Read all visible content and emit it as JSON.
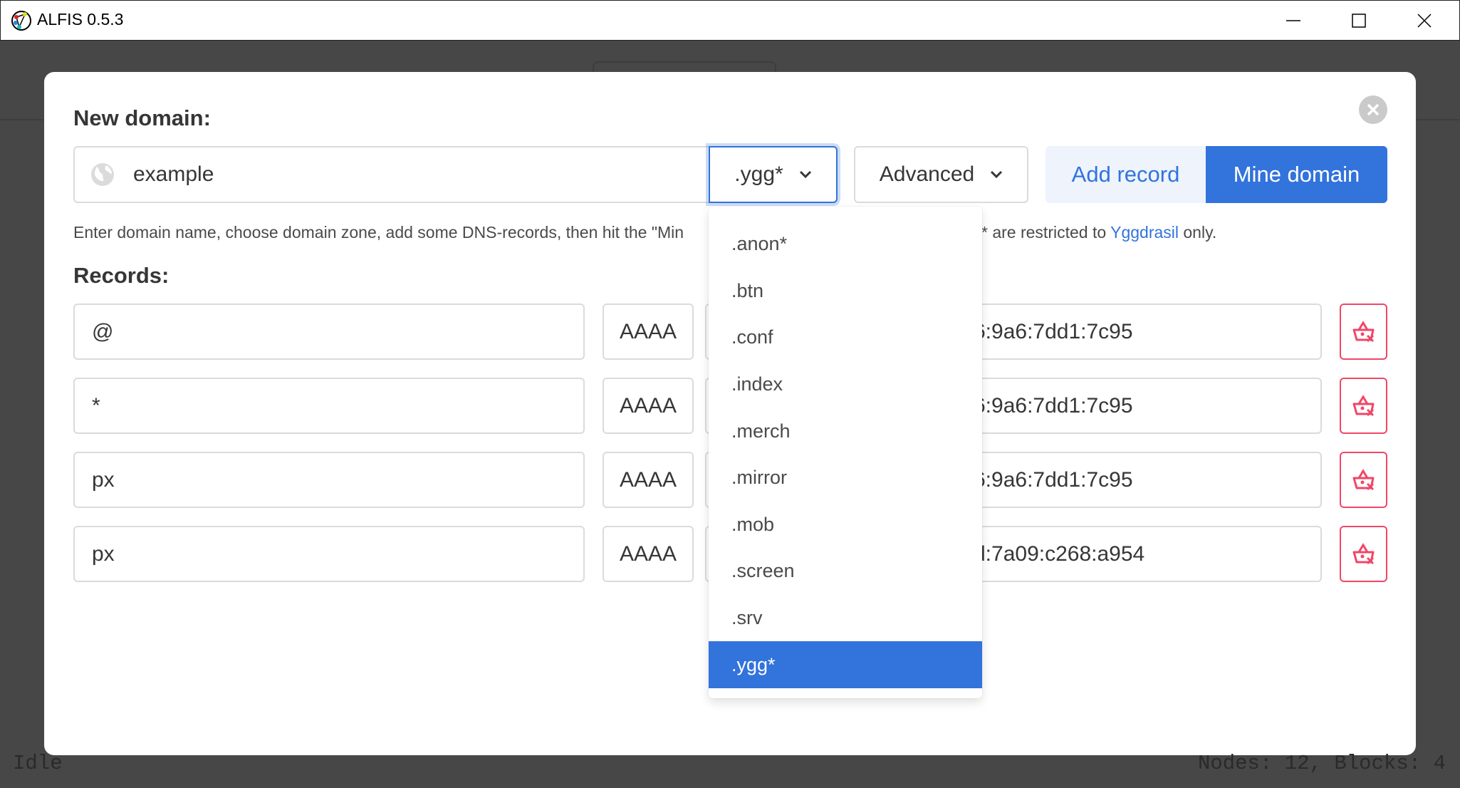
{
  "window": {
    "title": "ALFIS 0.5.3",
    "minimize_icon": "minimize-icon",
    "maximize_icon": "maximize-icon",
    "close_icon": "close-icon"
  },
  "modal": {
    "heading": "New domain:",
    "domain_input": {
      "value": "example",
      "icon": "globe-icon"
    },
    "zone_select": {
      "selected": ".ygg*"
    },
    "advanced": {
      "label": "Advanced"
    },
    "add_record_label": "Add record",
    "mine_domain_label": "Mine domain",
    "help_text_left": "Enter domain name, choose domain zone, add some DNS-records, then hit the \"Min",
    "help_text_right": "* are restricted to ",
    "help_link": "Yggdrasil",
    "help_text_end": " only.",
    "records_heading": "Records:",
    "records": [
      {
        "name": "@",
        "type": "AAAA",
        "value": "6:9a6:7dd1:7c95"
      },
      {
        "name": "*",
        "type": "AAAA",
        "value": "6:9a6:7dd1:7c95"
      },
      {
        "name": "px",
        "type": "AAAA",
        "value": "6:9a6:7dd1:7c95"
      },
      {
        "name": "px",
        "type": "AAAA",
        "value": "d:7a09:c268:a954"
      }
    ],
    "zone_options": [
      ".anon*",
      ".btn",
      ".conf",
      ".index",
      ".merch",
      ".mirror",
      ".mob",
      ".screen",
      ".srv",
      ".ygg*"
    ]
  },
  "status": {
    "left": "Idle",
    "right": "Nodes: 12, Blocks: 4"
  },
  "colors": {
    "primary": "#3273dc",
    "danger": "#f14668",
    "light_button": "#eef3fc",
    "background": "#474747"
  }
}
